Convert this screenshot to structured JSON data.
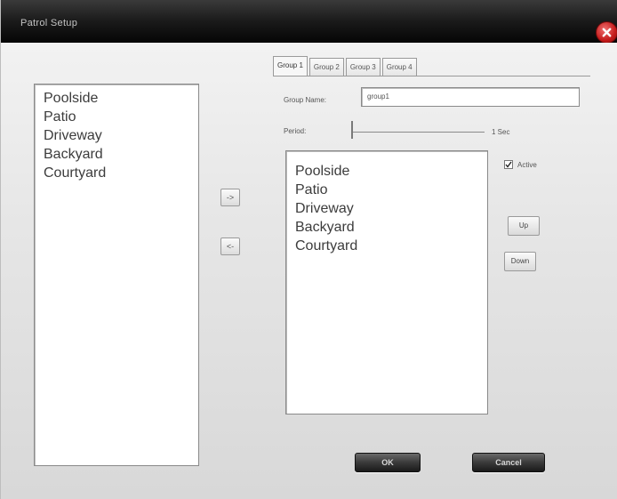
{
  "window": {
    "title": "Patrol Setup",
    "close_icon": "close-icon"
  },
  "available_list": {
    "items": [
      "Poolside",
      "Patio",
      "Driveway",
      "Backyard",
      "Courtyard"
    ]
  },
  "transfer": {
    "add_label": "->",
    "remove_label": "<-"
  },
  "tabs": [
    {
      "label": "Group 1",
      "active": true
    },
    {
      "label": "Group 2",
      "active": false
    },
    {
      "label": "Group 3",
      "active": false
    },
    {
      "label": "Group 4",
      "active": false
    }
  ],
  "group": {
    "name_label": "Group Name:",
    "name_value": "group1",
    "period_label": "Period:",
    "period_value": "1 Sec",
    "period_fraction": 0.0,
    "active_label": "Active",
    "active_checked": true,
    "items": [
      "Poolside",
      "Patio",
      "Driveway",
      "Backyard",
      "Courtyard"
    ],
    "up_label": "Up",
    "down_label": "Down"
  },
  "footer": {
    "ok_label": "OK",
    "cancel_label": "Cancel"
  },
  "colors": {
    "titlebar": "#111111",
    "close": "#c41a1a",
    "background": "#e4e4e4"
  }
}
